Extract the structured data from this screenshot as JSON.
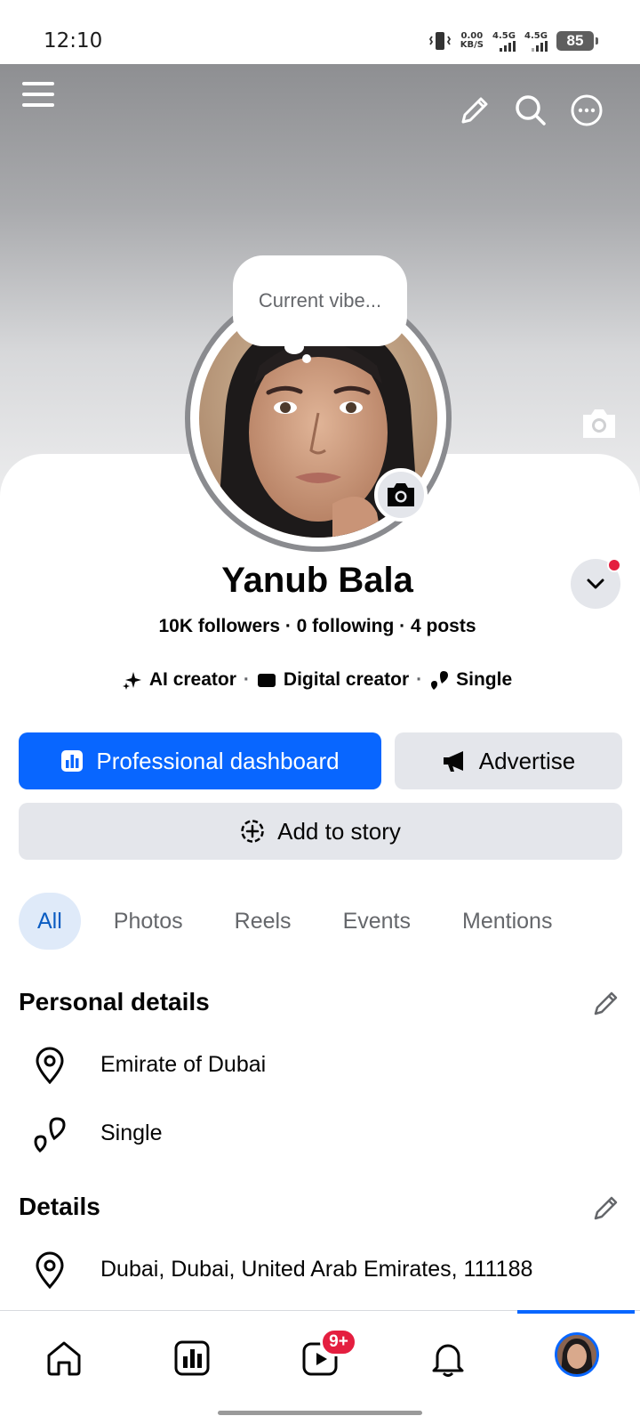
{
  "status_bar": {
    "time": "12:10",
    "net_speed_value": "0.00",
    "net_speed_unit": "KB/S",
    "sim1": "4.5G",
    "sim2": "4.5G",
    "battery": "85"
  },
  "profile": {
    "vibe_placeholder": "Current vibe...",
    "name": "Yanub Bala",
    "stats": "10K followers · 0 following · 4 posts",
    "tags": [
      {
        "label": "AI creator",
        "icon": "sparkle-icon"
      },
      {
        "label": "Digital creator",
        "icon": "video-camera-icon"
      },
      {
        "label": "Single",
        "icon": "hearts-icon"
      }
    ]
  },
  "actions": {
    "dashboard_label": "Professional dashboard",
    "advertise_label": "Advertise",
    "story_label": "Add to story"
  },
  "tabs": [
    "All",
    "Photos",
    "Reels",
    "Events",
    "Mentions"
  ],
  "personal_details": {
    "title": "Personal details",
    "items": [
      {
        "icon": "location-pin-icon",
        "text": "Emirate of Dubai"
      },
      {
        "icon": "hearts-icon",
        "text": "Single"
      }
    ]
  },
  "details": {
    "title": "Details",
    "items": [
      {
        "icon": "location-pin-icon",
        "text": "Dubai, Dubai, United Arab Emirates, 111188"
      }
    ]
  },
  "bottom_nav": {
    "video_badge": "9+"
  },
  "colors": {
    "accent": "#0866ff",
    "badge": "#e41e3f",
    "tab_active_bg": "#dfeaf9"
  }
}
